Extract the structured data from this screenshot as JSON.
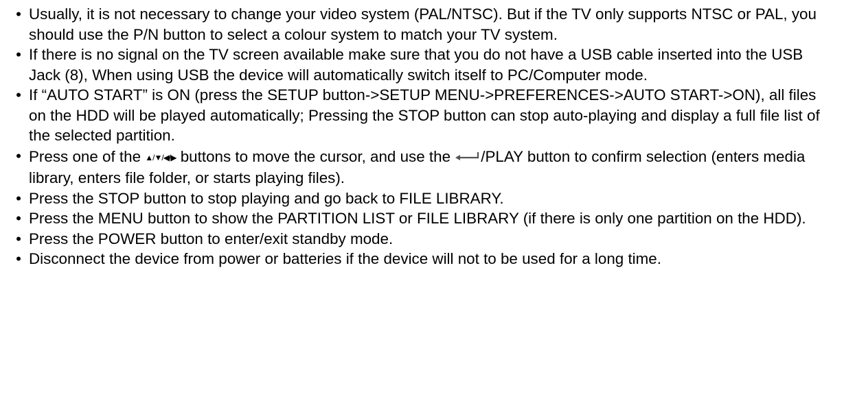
{
  "bullets": [
    {
      "text": "Usually, it is not necessary to change your video system (PAL/NTSC). But if the TV only supports NTSC or PAL, you should use the P/N button to select a colour system to match your TV system."
    },
    {
      "text": "If there is no signal on the TV screen available make sure that you do not have a USB cable inserted into the USB Jack (8), When using USB the device will automatically switch itself to PC/Computer mode."
    },
    {
      "text": "If “AUTO START” is ON (press the SETUP button->SETUP MENU->PREFERENCES->AUTO START->ON), all files on the HDD will be played automatically; Pressing the STOP button can stop auto-playing and display a full file list of the selected partition."
    },
    {
      "text_before": "Press one of the ",
      "icon_arrows": "arrow-buttons-icon",
      "text_middle": " buttons to move the cursor, and use the ",
      "icon_enter": "enter-icon",
      "text_after": "/PLAY button to confirm selection (enters media library, enters file folder, or starts playing files)."
    },
    {
      "text": "Press the STOP button to stop playing and go back to FILE LIBRARY."
    },
    {
      "text": "Press the MENU button to show the PARTITION LIST or FILE LIBRARY (if there is only one partition on the HDD)."
    },
    {
      "text": "Press the POWER button to enter/exit standby mode."
    },
    {
      "text": "Disconnect the device from power or batteries if the device will not to be used for a long time."
    }
  ]
}
